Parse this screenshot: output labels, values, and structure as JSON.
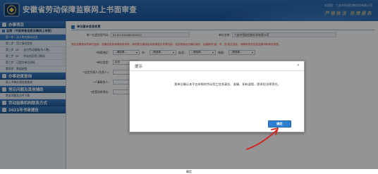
{
  "header": {
    "title": "安徽省劳动保障监察网上书面审查",
    "welcome": "欢迎您：六安市恒成包装印务有限公司",
    "slogan": "严格执法 热情服务"
  },
  "sidebar": {
    "section_1": "办事项目",
    "subhead": "监察（书面审查信息采集网上申报）",
    "items": [
      "第一步：法人单位基本信息",
      "第二步：用工情况信息",
      "第三步（A）：支付劳动报酬(年人数)",
      "第三步（B）：劳动合同签订情况",
      "第三步：已提交单位材料",
      "第四步：数据核报"
    ],
    "section_2": "办事进度查询",
    "item_2": "网上书审办理进度查询",
    "section_3": "常见问题及其他辅助",
    "item_3": "常见问题及文件下载",
    "section_4": "劳动监察机构联系方式",
    "section_5": "2021年书审通告"
  },
  "content": {
    "panel_title": "单位基本信息变更",
    "credit_code_label": "统一社会信用代码：",
    "credit_code_value": "91341500069294022",
    "unit_name_label": "单位名称：",
    "unit_name_value": "六安市恒成包装印务有限公司",
    "note": "请在如果核实的单位信息，如果信息有误请及时修改，修改提交保存后系统将显示变更内容，如变更请点击确认保存，后续操作(省、市、县)发生变化，请联系所在区县监察机构修改信息。",
    "area_label": "*所属地区：",
    "select_placeholder": "--请选择--",
    "city_label": "市：",
    "county_label": "县/区：",
    "street_label": "街道：",
    "type_label": "*单位类型：",
    "type_value": "企业",
    "legal_label": "*法定代表人(负责人)：",
    "contact_label": "*人事联系人：",
    "address_label": "*经营场所地址："
  },
  "dialog": {
    "title": "提示",
    "close": "✕",
    "body": "我单位确认本平台申报的劳动用工信息真实、准确、如有虚假，愿承担法律责任。",
    "confirm": "确定"
  },
  "footer": {
    "text": "确定"
  },
  "colors": {
    "header_blue": "#1e5aa0",
    "accent": "#2f7fd0",
    "warning_red": "#e2352a",
    "annotation_arrow": "#d2241a"
  }
}
